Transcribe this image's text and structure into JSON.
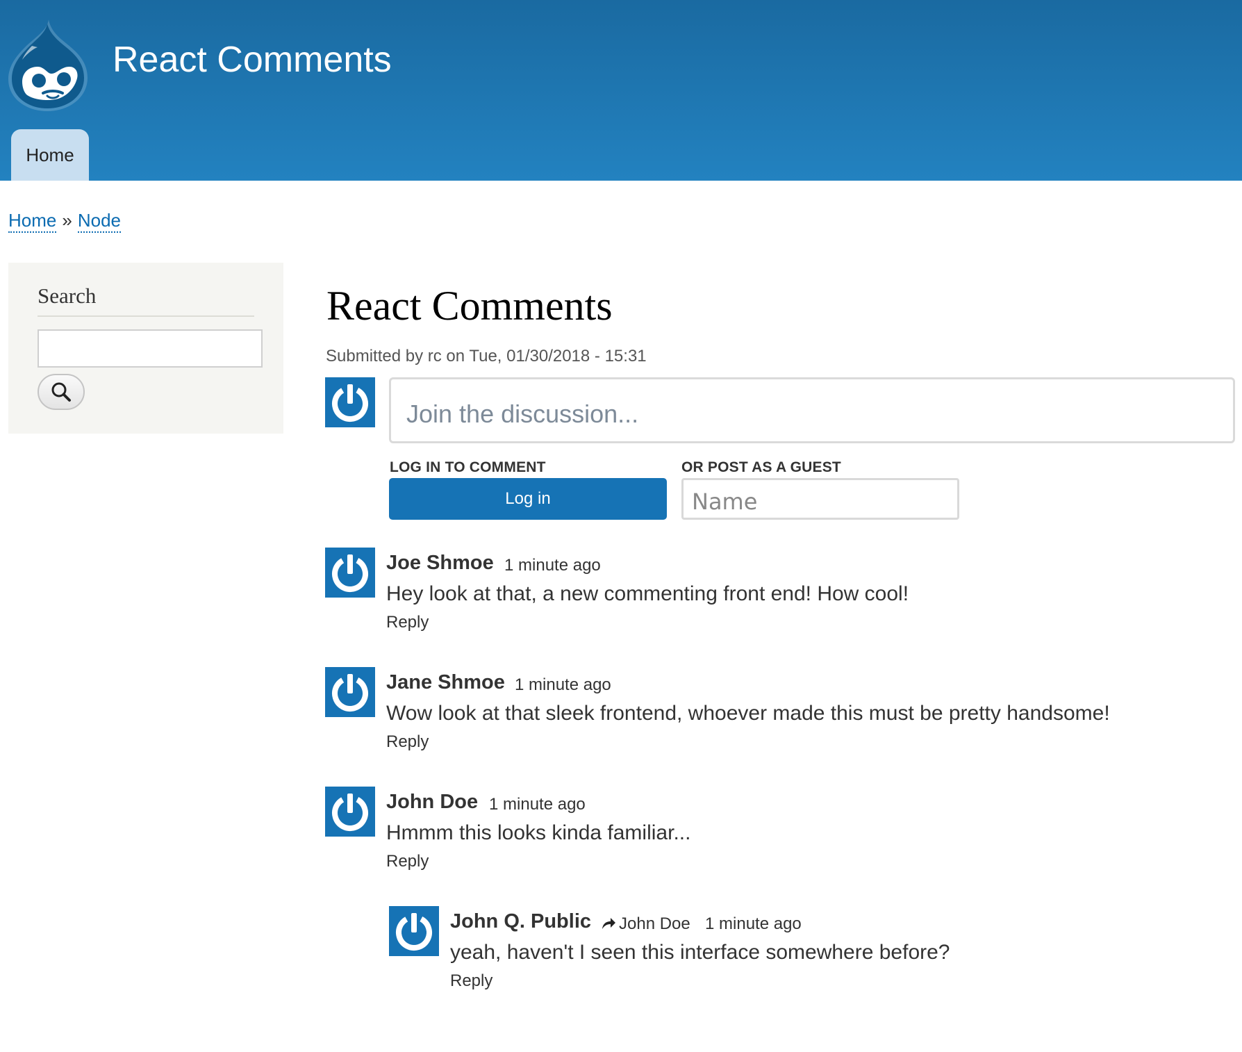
{
  "header": {
    "site_name": "React Comments",
    "nav": {
      "home_label": "Home"
    },
    "colors": {
      "header_top": "#1a6aa1",
      "header_bottom": "#2382c0",
      "accent": "#1673b5"
    }
  },
  "breadcrumb": {
    "items": [
      "Home",
      "Node"
    ],
    "separator": "»"
  },
  "sidebar": {
    "search_title": "Search",
    "search_button_icon": "search-icon"
  },
  "node": {
    "title": "React Comments",
    "submitted": "Submitted by rc on Tue, 01/30/2018 - 15:31"
  },
  "comment_form": {
    "placeholder": "Join the discussion...",
    "login_label": "LOG IN TO COMMENT",
    "login_button": "Log in",
    "guest_label": "OR POST AS A GUEST",
    "name_placeholder": "Name"
  },
  "comments": [
    {
      "author": "Joe Shmoe",
      "time": "1 minute ago",
      "text": "Hey look at that, a new commenting front end! How cool!",
      "reply": "Reply"
    },
    {
      "author": "Jane Shmoe",
      "time": "1 minute ago",
      "text": "Wow look at that sleek frontend, whoever made this must be pretty handsome!",
      "reply": "Reply"
    },
    {
      "author": "John Doe",
      "time": "1 minute ago",
      "text": "Hmmm this looks kinda familiar...",
      "reply": "Reply"
    },
    {
      "author": "John Q. Public",
      "reply_to": "John Doe",
      "time": "1 minute ago",
      "text": "yeah, haven't I seen this interface somewhere before?",
      "reply": "Reply"
    }
  ]
}
